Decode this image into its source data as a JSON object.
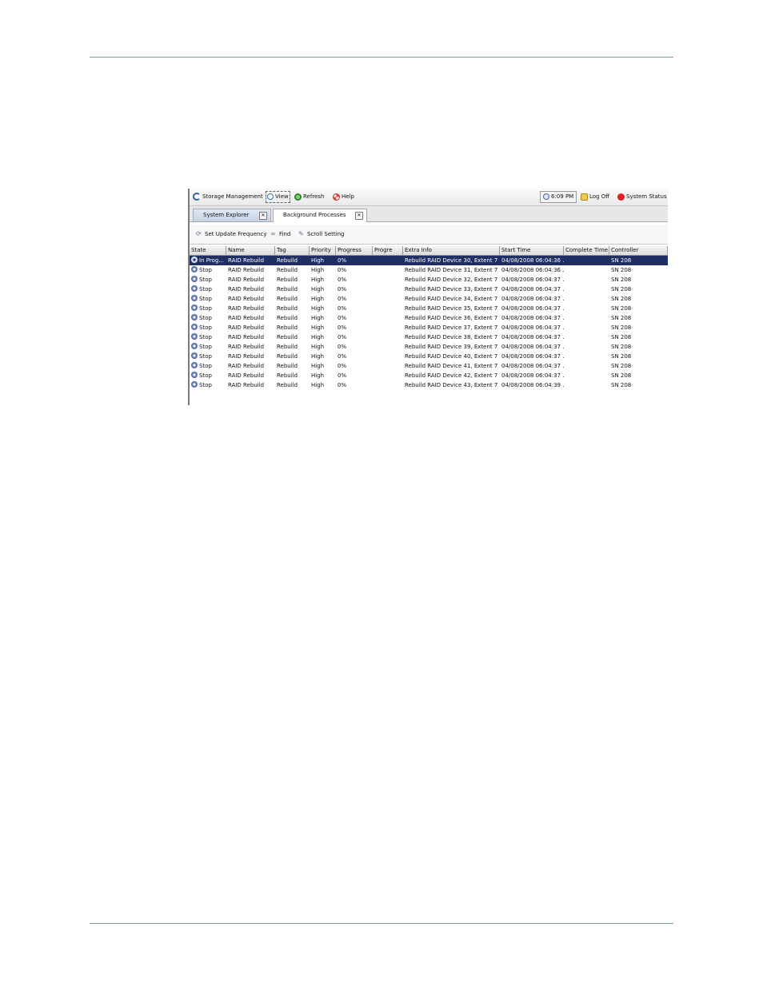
{
  "toolbar": {
    "storage_management": "Storage Management",
    "view": "View",
    "refresh": "Refresh",
    "help": "Help",
    "time": "6:09 PM",
    "log_off": "Log Off",
    "system_status": "System Status"
  },
  "tabs": [
    {
      "label": "System Explorer",
      "active": false
    },
    {
      "label": "Background Processes",
      "active": true
    }
  ],
  "actions": {
    "set_update_frequency": "Set Update Frequency",
    "find": "Find",
    "scroll_setting": "Scroll Setting"
  },
  "table": {
    "columns": [
      "State",
      "Name",
      "Tag",
      "Priority",
      "Progress",
      "Progre",
      "Extra Info",
      "Start Time",
      "Complete Time",
      "Controller"
    ],
    "rows": [
      [
        "In Prog...",
        "RAID Rebuild",
        "Rebuild",
        "High",
        "0%",
        "",
        "Rebuild RAID Device 30, Extent 7",
        "04/08/2008 06:04:36 ...",
        "",
        "SN 208"
      ],
      [
        "Stop",
        "RAID Rebuild",
        "Rebuild",
        "High",
        "0%",
        "",
        "Rebuild RAID Device 31, Extent 7",
        "04/08/2008 06:04:36 ...",
        "",
        "SN 208"
      ],
      [
        "Stop",
        "RAID Rebuild",
        "Rebuild",
        "High",
        "0%",
        "",
        "Rebuild RAID Device 32, Extent 7",
        "04/08/2008 06:04:37 ...",
        "",
        "SN 208"
      ],
      [
        "Stop",
        "RAID Rebuild",
        "Rebuild",
        "High",
        "0%",
        "",
        "Rebuild RAID Device 33, Extent 7",
        "04/08/2008 06:04:37 ...",
        "",
        "SN 208"
      ],
      [
        "Stop",
        "RAID Rebuild",
        "Rebuild",
        "High",
        "0%",
        "",
        "Rebuild RAID Device 34, Extent 7",
        "04/08/2008 06:04:37 ...",
        "",
        "SN 208"
      ],
      [
        "Stop",
        "RAID Rebuild",
        "Rebuild",
        "High",
        "0%",
        "",
        "Rebuild RAID Device 35, Extent 7",
        "04/08/2008 06:04:37 ...",
        "",
        "SN 208"
      ],
      [
        "Stop",
        "RAID Rebuild",
        "Rebuild",
        "High",
        "0%",
        "",
        "Rebuild RAID Device 36, Extent 7",
        "04/08/2008 06:04:37 ...",
        "",
        "SN 208"
      ],
      [
        "Stop",
        "RAID Rebuild",
        "Rebuild",
        "High",
        "0%",
        "",
        "Rebuild RAID Device 37, Extent 7",
        "04/08/2008 06:04:37 ...",
        "",
        "SN 208"
      ],
      [
        "Stop",
        "RAID Rebuild",
        "Rebuild",
        "High",
        "0%",
        "",
        "Rebuild RAID Device 38, Extent 7",
        "04/08/2008 06:04:37 ...",
        "",
        "SN 208"
      ],
      [
        "Stop",
        "RAID Rebuild",
        "Rebuild",
        "High",
        "0%",
        "",
        "Rebuild RAID Device 39, Extent 7",
        "04/08/2008 06:04:37 ...",
        "",
        "SN 208"
      ],
      [
        "Stop",
        "RAID Rebuild",
        "Rebuild",
        "High",
        "0%",
        "",
        "Rebuild RAID Device 40, Extent 7",
        "04/08/2008 06:04:37 ...",
        "",
        "SN 208"
      ],
      [
        "Stop",
        "RAID Rebuild",
        "Rebuild",
        "High",
        "0%",
        "",
        "Rebuild RAID Device 41, Extent 7",
        "04/08/2008 06:04:37 ...",
        "",
        "SN 208"
      ],
      [
        "Stop",
        "RAID Rebuild",
        "Rebuild",
        "High",
        "0%",
        "",
        "Rebuild RAID Device 42, Extent 7",
        "04/08/2008 06:04:37 ...",
        "",
        "SN 208"
      ],
      [
        "Stop",
        "RAID Rebuild",
        "Rebuild",
        "High",
        "0%",
        "",
        "Rebuild RAID Device 43, Extent 7",
        "04/08/2008 06:04:39 ...",
        "",
        "SN 208"
      ]
    ]
  },
  "colors": {
    "selection": "#1f2f66",
    "rule": "#6b9fb5",
    "status_icon": "#e02020"
  },
  "icons": {
    "storage_management": "storage-management-icon",
    "view": "magnifier-icon",
    "refresh": "refresh-icon",
    "help": "help-lifebuoy-icon",
    "clock": "clock-icon",
    "log_off": "log-off-icon",
    "system_status": "status-dot-icon",
    "row_state": "gear-icon"
  }
}
